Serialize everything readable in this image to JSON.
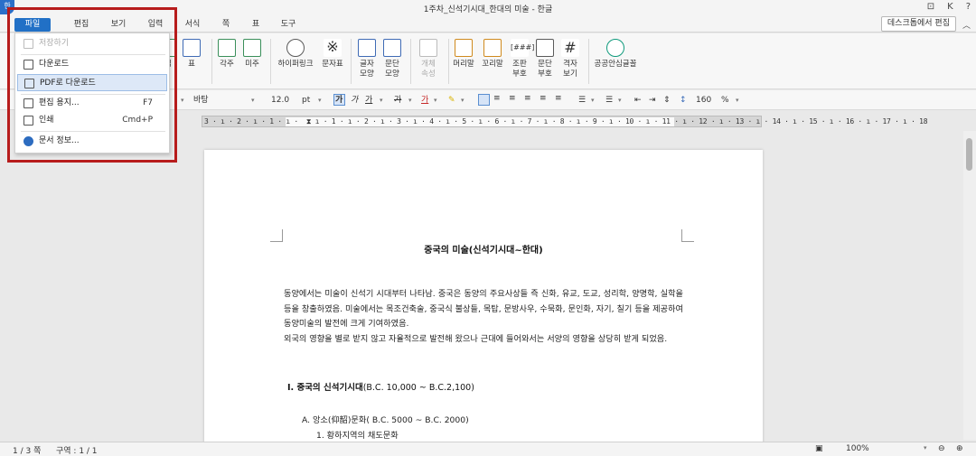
{
  "window": {
    "title": "1주차_신석기시대_한대의 미술 - 한글",
    "app_icon_text": "한",
    "right_controls": [
      "⊡",
      "K",
      "?"
    ]
  },
  "menubar": {
    "items": [
      "파일",
      "편집",
      "보기",
      "입력",
      "서식",
      "쪽",
      "표",
      "도구"
    ],
    "desktop_edit_button": "데스크톱에서 편집",
    "collapse_symbol": "︿"
  },
  "ribbon": {
    "partial_left": [
      "림",
      "표"
    ],
    "buttons": [
      {
        "label": "각주",
        "icon": "footnote-icon"
      },
      {
        "label": "미주",
        "icon": "endnote-icon"
      },
      {
        "label": "하이퍼링크",
        "icon": "hyperlink-icon"
      },
      {
        "label": "문자표",
        "icon": "symbol-icon"
      },
      {
        "label": "글자\n모양",
        "icon": "char-shape-icon"
      },
      {
        "label": "문단\n모양",
        "icon": "para-shape-icon"
      },
      {
        "label": "개체\n속성",
        "icon": "object-props-icon",
        "disabled": true
      },
      {
        "label": "머리말",
        "icon": "header-icon"
      },
      {
        "label": "꼬리말",
        "icon": "footer-icon"
      },
      {
        "label": "조판\n부호",
        "icon": "markup-icon"
      },
      {
        "label": "문단\n부호",
        "icon": "para-mark-icon"
      },
      {
        "label": "격자\n보기",
        "icon": "grid-icon"
      },
      {
        "label": "공공안심글꼴",
        "icon": "safe-font-icon"
      }
    ]
  },
  "format_bar": {
    "font": "바탕",
    "size": "12.0",
    "unit": "pt",
    "bold_glyph": "가",
    "italic_glyph": "가",
    "underline_glyph": "가",
    "strike_glyph": "가",
    "color_glyph": "가",
    "line_spacing": "160",
    "percent": "%"
  },
  "ruler": {
    "text": "3 · ı · 2 · ı · 1 · ı ·  ⧗ ı · 1 · ı · 2 · ı · 3 · ı · 4 · ı · 5 · ı · 6 · ı · 7 · ı · 8 · ı · 9 · ı · 10 · ı · 11 · ı · 12 · ı · 13 · ı · 14 · ı · 15 · ı · 16 · ı · 17 · ı · 18"
  },
  "file_menu": {
    "items": [
      {
        "label": "저장하기",
        "disabled": true,
        "icon": "save-icon"
      },
      {
        "label": "다운로드",
        "icon": "download-icon"
      },
      {
        "label": "PDF로 다운로드",
        "icon": "pdf-download-icon",
        "highlighted": true
      },
      {
        "label": "편집 용지...",
        "shortcut": "F7",
        "icon": "page-setup-icon"
      },
      {
        "label": "인쇄",
        "shortcut": "Cmd+P",
        "icon": "print-icon"
      },
      {
        "label": "문서 정보...",
        "icon": "info-icon"
      }
    ]
  },
  "document": {
    "title": "중국의  미술(신석기시대~한대)",
    "paragraph1": "동양에서는 미술이 신석기 시대부터 나타남. 중국은 동양의 주요사상들 즉 신화, 유교, 도교, 성리학, 양명학, 실학을 등을 창출하였음. 미술에서는 목조건축술, 중국식 불상들, 목탑, 문방사우, 수묵화, 문인화, 자기, 칠기 등을 제공하여 동양미술의 발전에 크게 기여하였음.",
    "paragraph2": "외국의 영향을 별로 받지 않고 자율적으로 발전해 왔으나 근대에 들어와서는 서양의 영향을 상당히 받게 되었음.",
    "heading_bold": "Ⅰ. 중국의  신석기시대",
    "heading_rest": "(B.C. 10,000  ~  B.C.2,100)",
    "sub_a": "A.  앙소(仰韶)문화(  B.C.  5000  ~  B.C.  2000)",
    "sub_1": "1.  황하지역의 채도문화"
  },
  "status": {
    "page": "1 / 3 쪽",
    "section": "구역 : 1 / 1",
    "zoom": "100%"
  }
}
